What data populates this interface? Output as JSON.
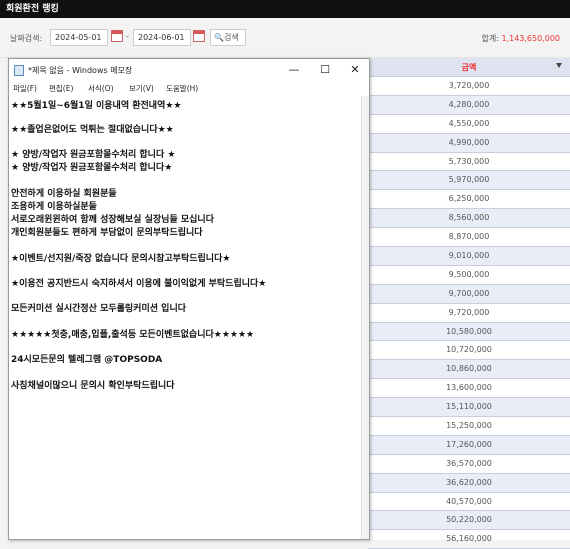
{
  "topbar": {
    "title": "회원환전 랭킹"
  },
  "filter": {
    "label": "날짜검색:",
    "start_date": "2024-05-01",
    "end_date": "2024-06-01",
    "separator": "-",
    "search_label": "검색",
    "total_label": "합계:",
    "total_value": "1,143,650,000"
  },
  "table": {
    "header": "금액",
    "rows": [
      "3,720,000",
      "4,280,000",
      "4,550,000",
      "4,990,000",
      "5,730,000",
      "5,970,000",
      "6,250,000",
      "8,560,000",
      "8,870,000",
      "9,010,000",
      "9,500,000",
      "9,700,000",
      "9,720,000",
      "10,580,000",
      "10,720,000",
      "10,860,000",
      "13,600,000",
      "15,110,000",
      "15,250,000",
      "17,260,000",
      "36,570,000",
      "36,620,000",
      "40,570,000",
      "50,220,000",
      "56,160,000"
    ]
  },
  "notepad": {
    "title": "*제목 없음 - Windows 메모장",
    "controls": {
      "minimize": "—",
      "maximize": "☐",
      "close": "✕"
    },
    "menu": [
      "파일(F)",
      "편집(E)",
      "서식(O)",
      "보기(V)",
      "도움말(H)"
    ],
    "lines": [
      "★★5월1일~6월1일 이용내역 환전내역★★",
      "★★졸업은없어도 먹튀는 절대없습니다★★",
      "★ 양방/작업자 원금포함몰수처리 합니다 ★",
      "★ 양방/작업자 원금포함몰수처리 합니다★",
      "안전하게 이용하실 회원분들",
      "조용하게 이용하실분들",
      "서로오래윈윈하여 함께 성장해보실 실장님들 모십니다",
      "개인회원분들도 편하게 부담없이 문의부탁드립니다",
      "★이벤트/선지원/죽장 없습니다 문의시참고부탁드립니다★",
      "★이용전 공지반드시 숙지하셔서 이용에 불이익없게 부탁드립니다★",
      "모든커미션 실시간정산 모두롤링커미션 입니다",
      "★★★★★첫충,매충,입플,출석등 모든이벤트없습니다★★★★★",
      "24시모든문의 텔레그램 @TOPSODA",
      "사칭채널이많으니 문의시 확인부탁드립니다"
    ]
  }
}
